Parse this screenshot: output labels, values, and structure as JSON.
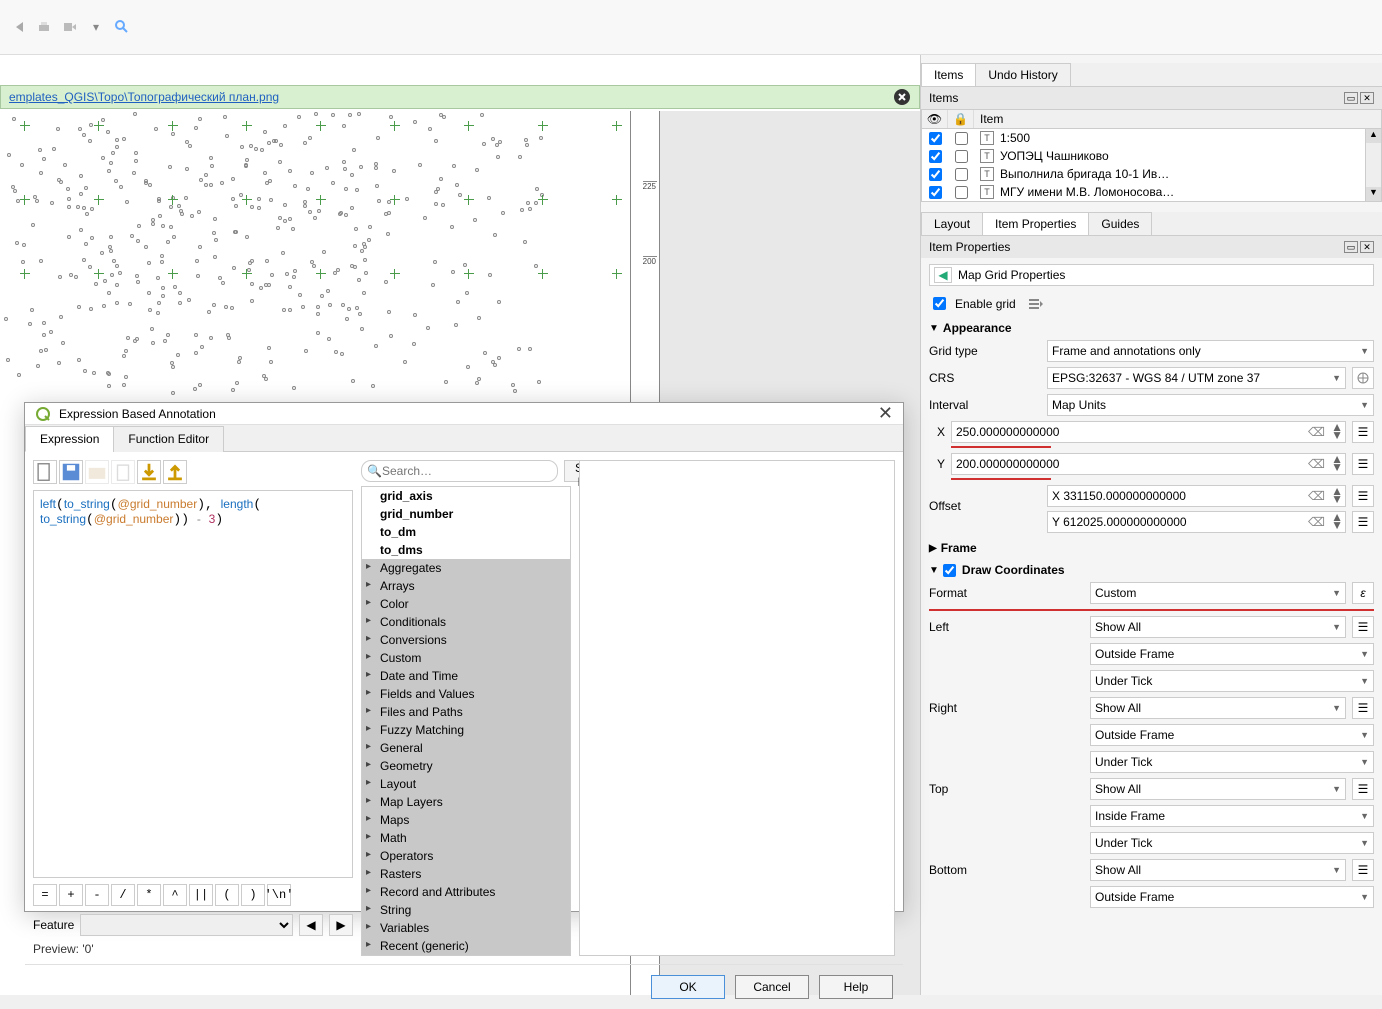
{
  "file_bar": {
    "path": "emplates_QGIS\\Торо\\Топографический план.png"
  },
  "ruler": {
    "t1": "225",
    "t2": "200"
  },
  "dialog": {
    "title": "Expression Based Annotation",
    "tabs": {
      "expression": "Expression",
      "func_editor": "Function Editor"
    },
    "code_html": "<span class='kw'>left</span>(<span class='kw'>to_string</span>(<span class='id'>@grid_number</span>), <span class='kw'>length</span>(\n<span class='kw'>to_string</span>(<span class='id'>@grid_number</span>)) <span class='op'>-</span> <span class='num'>3</span>)",
    "ops": [
      "=",
      "+",
      "-",
      "/",
      "*",
      "^",
      "||",
      "(",
      ")",
      "'\\n'"
    ],
    "feature_label": "Feature",
    "preview": "Preview:  '0'",
    "search_placeholder": "Search…",
    "show_help": "Show Help",
    "leafs": [
      "grid_axis",
      "grid_number",
      "to_dm",
      "to_dms"
    ],
    "groups": [
      "Aggregates",
      "Arrays",
      "Color",
      "Conditionals",
      "Conversions",
      "Custom",
      "Date and Time",
      "Fields and Values",
      "Files and Paths",
      "Fuzzy Matching",
      "General",
      "Geometry",
      "Layout",
      "Map Layers",
      "Maps",
      "Math",
      "Operators",
      "Rasters",
      "Record and Attributes",
      "String",
      "Variables",
      "Recent (generic)"
    ],
    "buttons": {
      "ok": "OK",
      "cancel": "Cancel",
      "help": "Help"
    }
  },
  "right": {
    "tabs1": {
      "items": "Items",
      "undo": "Undo History"
    },
    "items_hdr": "Items",
    "item_col": "Item",
    "items": [
      {
        "label": "1:500"
      },
      {
        "label": "УОПЭЦ Чашниково"
      },
      {
        "label": "Выполнила бригада 10-1 Ив…"
      },
      {
        "label": "МГУ имени М.В. Ломоносова…"
      }
    ],
    "tabs2": {
      "layout": "Layout",
      "props": "Item Properties",
      "guides": "Guides"
    },
    "props_hdr": "Item Properties",
    "crumb": "Map Grid Properties",
    "enable_grid": "Enable grid",
    "appearance": "Appearance",
    "grid_type_lbl": "Grid type",
    "grid_type_val": "Frame and annotations only",
    "crs_lbl": "CRS",
    "crs_val": "EPSG:32637 - WGS 84 / UTM zone 37",
    "interval_lbl": "Interval",
    "interval_val": "Map Units",
    "x_lbl": "X",
    "x_val": "250.000000000000",
    "y_lbl": "Y",
    "y_val": "200.000000000000",
    "offset_lbl": "Offset",
    "ox_val": "X 331150.000000000000",
    "oy_val": "Y 612025.000000000000",
    "frame": "Frame",
    "draw_coords": "Draw Coordinates",
    "format_lbl": "Format",
    "format_val": "Custom",
    "eps": "ε",
    "sides": {
      "left": "Left",
      "right": "Right",
      "top": "Top",
      "bottom": "Bottom",
      "show_all": "Show All",
      "outside": "Outside Frame",
      "inside": "Inside Frame",
      "under_tick": "Under Tick"
    }
  }
}
